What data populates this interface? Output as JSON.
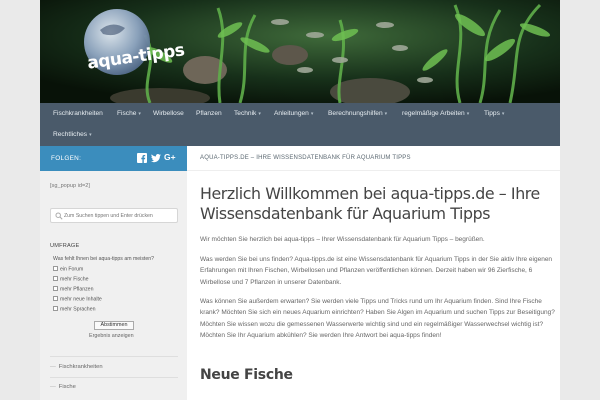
{
  "brand": {
    "logo_text": "aqua-tipps"
  },
  "nav": {
    "items": [
      {
        "label": "Fischkrankheiten",
        "caret": false
      },
      {
        "label": "Fische",
        "caret": true
      },
      {
        "label": "Wirbellose",
        "caret": false
      },
      {
        "label": "Pflanzen",
        "caret": false
      },
      {
        "label": "Technik",
        "caret": true
      },
      {
        "label": "Anleitungen",
        "caret": true
      },
      {
        "label": "Berechnungshilfen",
        "caret": true
      },
      {
        "label": "regelmäßige Arbeiten",
        "caret": true
      },
      {
        "label": "Tipps",
        "caret": true
      },
      {
        "label": "Rechtliches",
        "caret": true
      }
    ],
    "caret_symbol": "▾"
  },
  "sidebar": {
    "follow_label": "FOLGEN:",
    "social": [
      "facebook-icon",
      "twitter-icon",
      "google-plus-icon"
    ],
    "shortcode": "[sg_popup id=2]",
    "search_placeholder": "Zum Suchen tippen und Enter drücken",
    "poll": {
      "title": "UMFRAGE",
      "question": "Was fehlt Ihnen bei aqua-tipps am meisten?",
      "options": [
        "ein Forum",
        "mehr Fische",
        "mehr Pflanzen",
        "mehr neue Inhalte",
        "mehr Sprachen"
      ],
      "vote_label": "Abstimmen",
      "results_label": "Ergebnis anzeigen"
    },
    "links": [
      "Fischkrankheiten",
      "Fische"
    ]
  },
  "content": {
    "breadcrumb": "AQUA-TIPPS.DE – IHRE WISSENSDATENBANK FÜR AQUARIUM TIPPS",
    "title": "Herzlich Willkommen bei aqua-tipps.de – Ihre Wissensdatenbank für Aquarium Tipps",
    "paragraphs": [
      "Wir möchten Sie herzlich bei aqua-tipps – Ihrer Wissensdatenbank für Aquarium Tipps – begrüßen.",
      "Was werden Sie bei uns finden? Aqua-tipps.de ist eine Wissensdatenbank für Aquarium Tipps in der Sie aktiv Ihre eigenen Erfahrungen mit Ihren Fischen, Wirbellosen und Pflanzen veröffentlichen können. Derzeit haben wir 96 Zierfische, 6 Wirbellose und 7 Pflanzen in unserer Datenbank.",
      "Was können Sie außerdem erwarten? Sie werden viele Tipps und Tricks rund um Ihr Aquarium finden. Sind Ihre Fische krank? Möchten Sie sich ein neues Aquarium einrichten? Haben Sie Algen im Aquarium und suchen Tipps zur Beseitigung? Möchten Sie wissen wozu die gemessenen Wasserwerte wichtig sind und ein regelmäßiger Wasserwechsel wichtig ist? Möchten Sie Ihr Aquarium abkühlen? Sie werden Ihre Antwort bei aqua-tipps finden!"
    ],
    "section_heading": "Neue Fische"
  },
  "colors": {
    "nav_bg": "#4a5a6a",
    "follow_bg": "#3b8dbd",
    "sidebar_bg": "#f0f0f0",
    "page_bg": "#eaeaea"
  }
}
